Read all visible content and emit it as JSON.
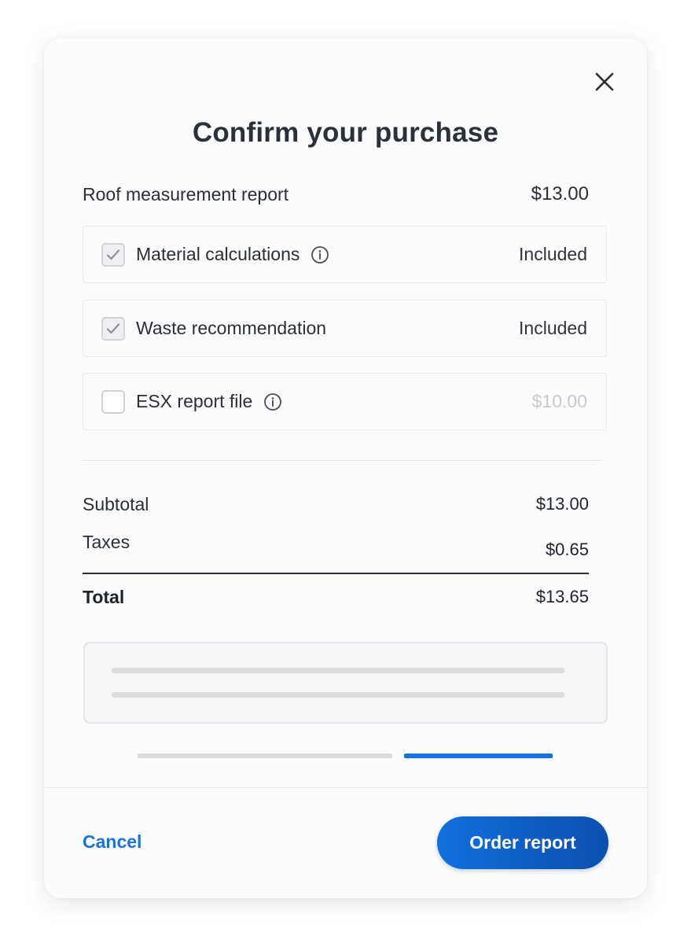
{
  "modal": {
    "title": "Confirm your purchase",
    "close_icon": "close-icon"
  },
  "report": {
    "label": "Roof measurement report",
    "price": "$13.00"
  },
  "options": [
    {
      "label": "Material calculations",
      "value": "Included",
      "checked": true,
      "has_info": true
    },
    {
      "label": "Waste recommendation",
      "value": "Included",
      "checked": true,
      "has_info": false
    },
    {
      "label": "ESX report file",
      "value": "$10.00",
      "checked": false,
      "has_info": true
    }
  ],
  "summary": {
    "subtotal_label": "Subtotal",
    "subtotal_value": "$13.00",
    "taxes_label": "Taxes",
    "taxes_value": "$0.65",
    "total_label": "Total",
    "total_value": "$13.65"
  },
  "progress": {
    "steps": 2,
    "current_step": 2
  },
  "footer": {
    "cancel_label": "Cancel",
    "order_label": "Order report"
  },
  "colors": {
    "accent": "#1a73d9",
    "button_gradient_start": "#1170de",
    "button_gradient_end": "#0c4fae",
    "progress_active": "#1570e0",
    "progress_inactive": "#d9dadd"
  }
}
